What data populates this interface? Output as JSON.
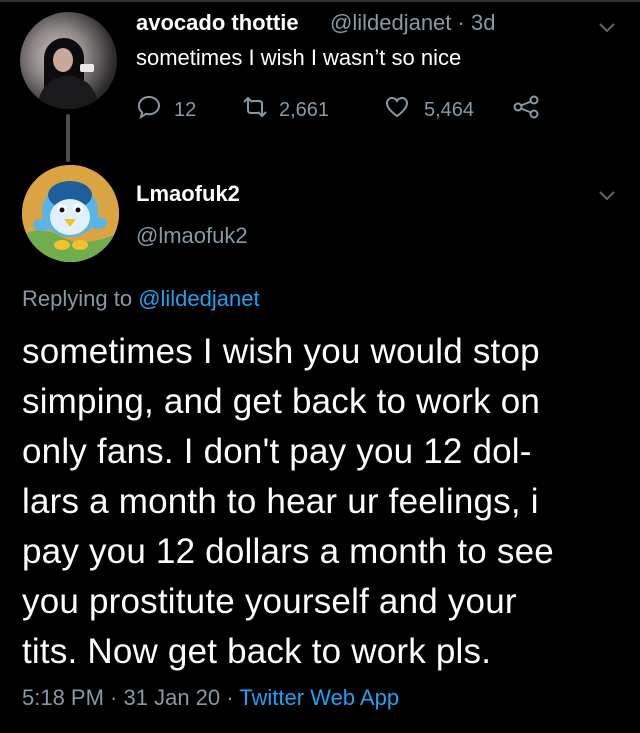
{
  "parent_tweet": {
    "display_name": "avocado thottie",
    "handle": "@lildedjanet",
    "separator": " · ",
    "age": "3d",
    "text": "sometimes I wish I wasn’t so nice",
    "reply_count": "12",
    "retweet_count": "2,661",
    "like_count": "5,464",
    "icons": [
      "comment-icon",
      "retweet-icon",
      "heart-icon",
      "share-icon",
      "chevron-down-icon"
    ]
  },
  "reply_tweet": {
    "display_name": "Lmaofuk2",
    "handle": "@lmaofuk2",
    "replying_prefix": "Replying to ",
    "replying_mention": "@lildedjanet",
    "text_lines": [
      "sometimes I wish you would stop",
      "simping, and get back to work on",
      "only fans. I don't pay you 12 dol-",
      "lars a month to hear ur feelings, i",
      "pay you 12 dollars a month to see",
      "you prostitute yourself and your",
      "tits. Now get back to work pls."
    ],
    "time": "5:18 PM",
    "separator1": " · ",
    "date": "31 Jan 20",
    "separator2": " · ",
    "source_app": "Twitter Web App"
  },
  "colors": {
    "background": "#000000",
    "primary_text": "#ffffff",
    "secondary_text": "#8899a6",
    "link": "#1da1f2"
  }
}
